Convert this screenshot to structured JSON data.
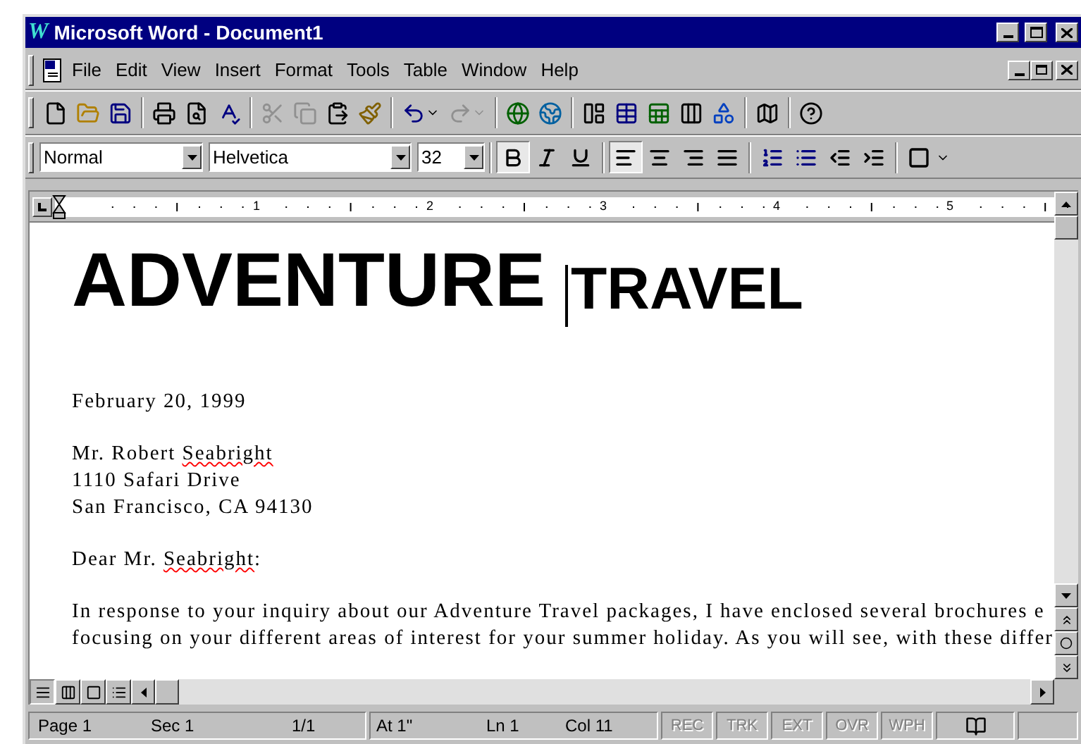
{
  "window": {
    "logo": "W",
    "title": "Microsoft Word - Document1"
  },
  "menu": [
    "File",
    "Edit",
    "View",
    "Insert",
    "Format",
    "Tools",
    "Table",
    "Window",
    "Help"
  ],
  "standard_toolbar": [
    {
      "kind": "new",
      "disabled": false
    },
    {
      "kind": "open",
      "disabled": false
    },
    {
      "kind": "save",
      "disabled": false
    },
    {
      "kind": "sep"
    },
    {
      "kind": "print",
      "disabled": false
    },
    {
      "kind": "preview",
      "disabled": false
    },
    {
      "kind": "spelling",
      "disabled": false
    },
    {
      "kind": "sep"
    },
    {
      "kind": "cut",
      "disabled": true
    },
    {
      "kind": "copy",
      "disabled": true
    },
    {
      "kind": "paste",
      "disabled": false
    },
    {
      "kind": "painter",
      "disabled": false
    },
    {
      "kind": "sep"
    },
    {
      "kind": "undo",
      "disabled": false
    },
    {
      "kind": "redo",
      "disabled": true
    },
    {
      "kind": "sep"
    },
    {
      "kind": "hyperlink",
      "disabled": false
    },
    {
      "kind": "web",
      "disabled": false
    },
    {
      "kind": "sep"
    },
    {
      "kind": "tables",
      "disabled": false
    },
    {
      "kind": "table",
      "disabled": false
    },
    {
      "kind": "sheet",
      "disabled": false
    },
    {
      "kind": "columns",
      "disabled": false
    },
    {
      "kind": "drawing",
      "disabled": false
    },
    {
      "kind": "sep"
    },
    {
      "kind": "map",
      "disabled": false
    },
    {
      "kind": "sep"
    },
    {
      "kind": "help",
      "disabled": false
    }
  ],
  "formatting_toolbar": {
    "style": "Normal",
    "font": "Helvetica",
    "size": "32",
    "buttons": [
      {
        "kind": "bold",
        "pressed": true
      },
      {
        "kind": "italic",
        "pressed": false
      },
      {
        "kind": "underline",
        "pressed": false
      },
      {
        "kind": "sep"
      },
      {
        "kind": "align-left",
        "pressed": true
      },
      {
        "kind": "center",
        "pressed": false
      },
      {
        "kind": "align-right",
        "pressed": false
      },
      {
        "kind": "justify",
        "pressed": false
      },
      {
        "kind": "sep"
      },
      {
        "kind": "numbering",
        "pressed": false
      },
      {
        "kind": "bullets",
        "pressed": false
      },
      {
        "kind": "outdent",
        "pressed": false
      },
      {
        "kind": "indent",
        "pressed": false
      },
      {
        "kind": "sep"
      },
      {
        "kind": "border",
        "pressed": false
      }
    ]
  },
  "ruler": [
    "1",
    "2",
    "3",
    "4",
    "5"
  ],
  "document": {
    "heading": [
      "ADVENTURE",
      "TRAVEL"
    ],
    "paragraphs": [
      [
        [
          {
            "text": "February 20, 1999",
            "misspelled": false
          }
        ]
      ],
      [
        [
          {
            "text": "Mr. Robert ",
            "misspelled": false
          },
          {
            "text": "Seabright",
            "misspelled": true
          }
        ],
        [
          {
            "text": "1110 Safari Drive",
            "misspelled": false
          }
        ],
        [
          {
            "text": "San Francisco, CA 94130",
            "misspelled": false
          }
        ]
      ],
      [
        [
          {
            "text": "Dear Mr. ",
            "misspelled": false
          },
          {
            "text": "Seabright",
            "misspelled": true
          },
          {
            "text": ":",
            "misspelled": false
          }
        ]
      ],
      [
        [
          {
            "text": "In response to your inquiry about our Adventure Travel packages, I have enclosed several brochures e",
            "misspelled": false
          }
        ],
        [
          {
            "text": "focusing on your different areas of interest for your summer holiday. As you will see, with these differ",
            "misspelled": false
          }
        ]
      ]
    ]
  },
  "status_bar": {
    "page": "Page 1",
    "sec": "Sec 1",
    "pages": "1/1",
    "at": "At 1\"",
    "ln": "Ln 1",
    "col": "Col 11",
    "indicators": [
      {
        "label": "REC",
        "disabled": true
      },
      {
        "label": "TRK",
        "disabled": true
      },
      {
        "label": "EXT",
        "disabled": true
      },
      {
        "label": "OVR",
        "disabled": true
      },
      {
        "label": "WPH",
        "disabled": true
      }
    ]
  }
}
